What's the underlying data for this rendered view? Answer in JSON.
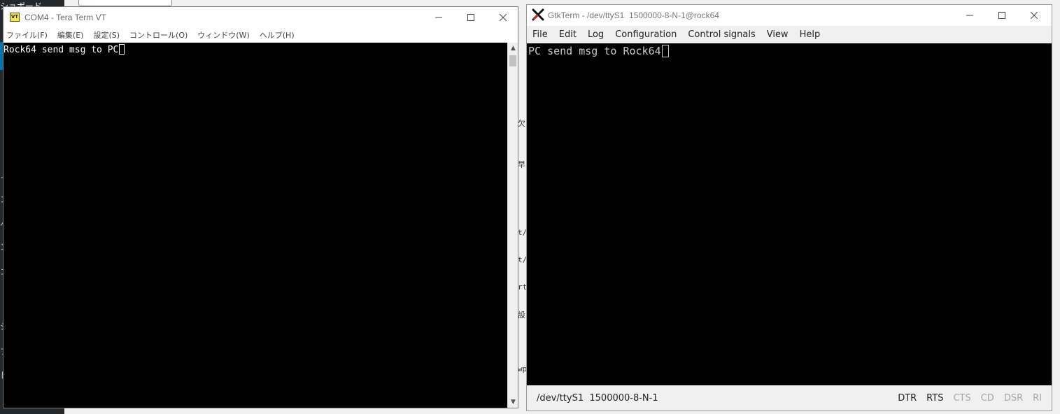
{
  "colors": {
    "terminal_bg": "#000000",
    "teraterm_text": "#ffffff",
    "gtkterm_text": "#c8c8c8",
    "signal_active": "#222222",
    "signal_inactive": "#a6a6a6"
  },
  "teraterm": {
    "title": "COM4 - Tera Term VT",
    "icon": "teraterm-vt-icon",
    "icon_text": "VT",
    "menu": [
      "ファイル(F)",
      "編集(E)",
      "設定(S)",
      "コントロール(O)",
      "ウィンドウ(W)",
      "ヘルプ(H)"
    ],
    "terminal_text": "Rock64 send msg to PC"
  },
  "gtkterm": {
    "title": "GtkTerm - /dev/ttyS1  1500000-8-N-1@rock64",
    "icon": "gtkterm-x-icon",
    "menu": [
      "File",
      "Edit",
      "Log",
      "Configuration",
      "Control signals",
      "View",
      "Help"
    ],
    "terminal_text": "PC send msg to Rock64",
    "status": {
      "port": "/dev/ttyS1  1500000-8-N-1",
      "signals": [
        {
          "label": "DTR",
          "active": true
        },
        {
          "label": "RTS",
          "active": true
        },
        {
          "label": "CTS",
          "active": false
        },
        {
          "label": "CD",
          "active": false
        },
        {
          "label": "DSR",
          "active": false
        },
        {
          "label": "RI",
          "active": false
        }
      ]
    }
  },
  "background": {
    "sidebar_top_text": "ショボード",
    "sidebar_fragments": [
      "ィ",
      "ン",
      "ヘ",
      "ン",
      "コ",
      "シ",
      "フ",
      "し"
    ],
    "page_fragments": [
      "欠",
      "早",
      "t/",
      "t/",
      "rt",
      "設",
      "wp"
    ]
  }
}
